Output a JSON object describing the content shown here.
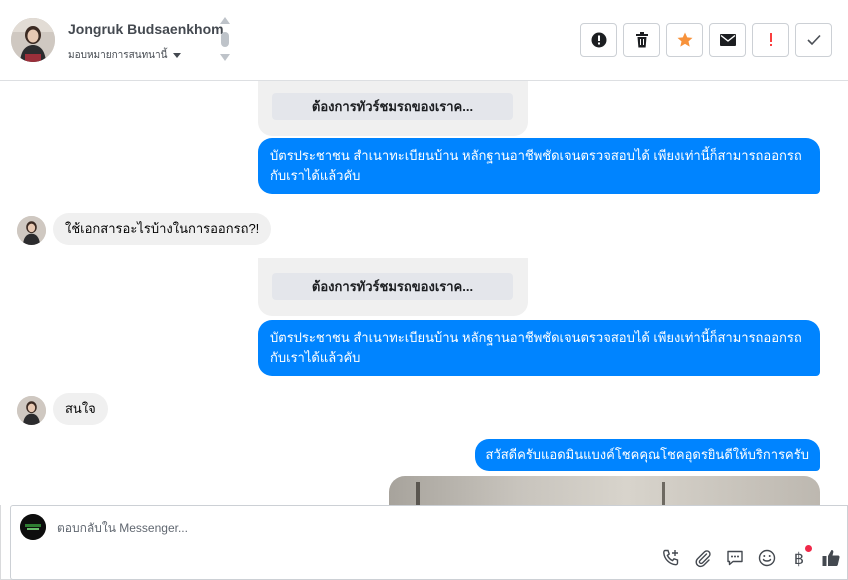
{
  "header": {
    "contact_name": "Jongruk Budsaenkhom",
    "assign_label": "มอบหมายการสนทนานี้",
    "actions": [
      {
        "name": "mark-spam-button",
        "icon": "alert-circle-icon"
      },
      {
        "name": "delete-button",
        "icon": "trash-icon"
      },
      {
        "name": "star-button",
        "icon": "star-icon"
      },
      {
        "name": "mark-unread-button",
        "icon": "envelope-icon"
      },
      {
        "name": "follow-up-button",
        "icon": "exclamation-icon"
      },
      {
        "name": "mark-done-button",
        "icon": "check-icon"
      }
    ]
  },
  "messages": {
    "card_button_1": "ต้องการทัวร์ชมรถของเราค...",
    "reply_1": "บัตรประชาชน สำเนาทะเบียนบ้าน หลักฐานอาชีพชัดเจนตรวจสอบได้ เพียงเท่านี้ก็สามารถออกรถกับเราได้แล้วคับ",
    "incoming_1": "ใช้เอกสารอะไรบ้างในการออกรถ?!",
    "card_button_2": "ต้องการทัวร์ชมรถของเราค...",
    "reply_2": "บัตรประชาชน สำเนาทะเบียนบ้าน หลักฐานอาชีพชัดเจนตรวจสอบได้ เพียงเท่านี้ก็สามารถออกรถกับเราได้แล้วคับ",
    "incoming_2": "สนใจ",
    "reply_3": "สวัสดีครับแอดมินแบงค์โชคคุณโชคอุดรยินดีให้บริการครับ"
  },
  "composer": {
    "placeholder": "ตอบกลับใน Messenger...",
    "tools": [
      "call-icon",
      "attachment-icon",
      "saved-replies-icon",
      "emoji-icon",
      "payment-icon",
      "like-icon"
    ],
    "currency_symbol": "฿"
  },
  "colors": {
    "outgoing_bubble": "#0084ff",
    "incoming_bubble": "#f0f0f0",
    "star": "#f7923b",
    "follow_up": "#fa3e3e",
    "notification_dot": "#f02849"
  }
}
